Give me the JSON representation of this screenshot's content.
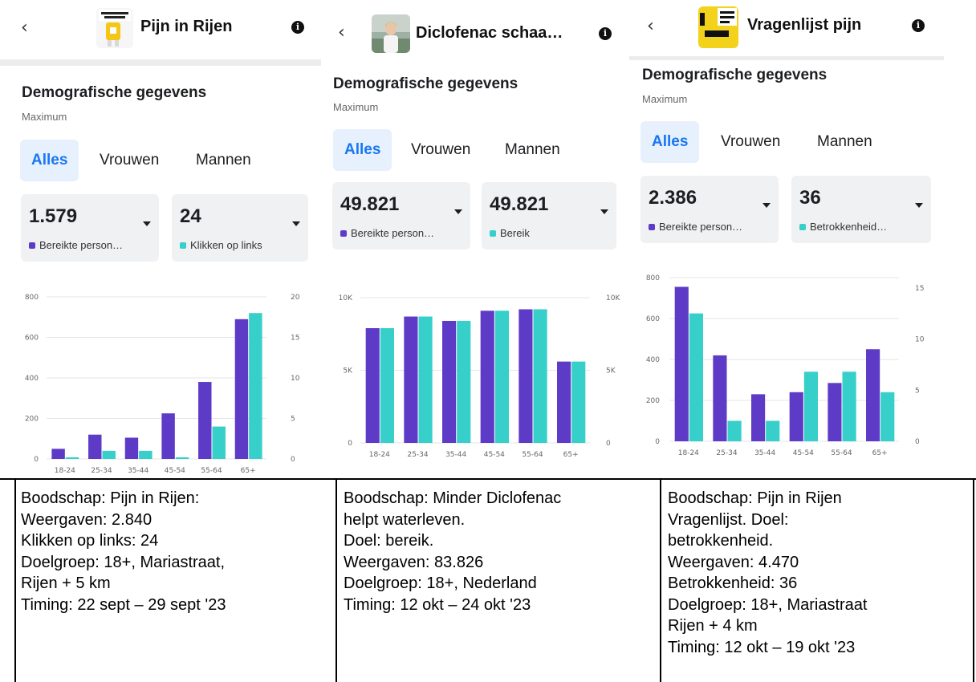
{
  "colors": {
    "purple": "#5e3bc6",
    "teal": "#36cfc9",
    "accent": "#1877f2"
  },
  "panels": [
    {
      "title": "Pijn in Rijen",
      "section_title": "Demografische gegevens",
      "section_sub": "Maximum",
      "tabs": [
        "Alles",
        "Vrouwen",
        "Mannen"
      ],
      "cards": [
        {
          "value": "1.579",
          "label": "Bereikte person…",
          "color": "#5e3bc6"
        },
        {
          "value": "24",
          "label": "Klikken op links",
          "color": "#36cfc9"
        }
      ],
      "chart_data": {
        "type": "bar",
        "categories": [
          "18-24",
          "25-34",
          "35-44",
          "45-54",
          "55-64",
          "65+"
        ],
        "series": [
          {
            "axis": "left",
            "values": [
              50,
              120,
              105,
              225,
              380,
              690
            ]
          },
          {
            "axis": "right",
            "values": [
              0.2,
              1,
              1,
              0.2,
              4,
              18
            ]
          }
        ],
        "left_ticks": [
          "0",
          "200",
          "400",
          "600",
          "800"
        ],
        "right_ticks": [
          "0",
          "5",
          "10",
          "15",
          "20"
        ],
        "ylim_left": [
          0,
          800
        ],
        "ylim_right": [
          0,
          20
        ]
      }
    },
    {
      "title": "Diclofenac schaa…",
      "section_title": "Demografische gegevens",
      "section_sub": "Maximum",
      "tabs": [
        "Alles",
        "Vrouwen",
        "Mannen"
      ],
      "cards": [
        {
          "value": "49.821",
          "label": "Bereikte person…",
          "color": "#5e3bc6"
        },
        {
          "value": "49.821",
          "label": "Bereik",
          "color": "#36cfc9"
        }
      ],
      "chart_data": {
        "type": "bar",
        "categories": [
          "18-24",
          "25-34",
          "35-44",
          "45-54",
          "55-64",
          "65+"
        ],
        "series": [
          {
            "axis": "left",
            "values": [
              7900,
              8700,
              8400,
              9100,
              9200,
              5600
            ]
          },
          {
            "axis": "right",
            "values": [
              7900,
              8700,
              8400,
              9100,
              9200,
              5600
            ]
          }
        ],
        "left_ticks": [
          "0",
          "5K",
          "10K"
        ],
        "right_ticks": [
          "0",
          "5K",
          "10K"
        ],
        "ylim_left": [
          0,
          10000
        ],
        "ylim_right": [
          0,
          10000
        ]
      }
    },
    {
      "title": "Vragenlijst pijn",
      "section_title": "Demografische gegevens",
      "section_sub": "Maximum",
      "tabs": [
        "Alles",
        "Vrouwen",
        "Mannen"
      ],
      "cards": [
        {
          "value": "2.386",
          "label": "Bereikte person…",
          "color": "#5e3bc6"
        },
        {
          "value": "36",
          "label": "Betrokkenheid…",
          "color": "#36cfc9"
        }
      ],
      "chart_data": {
        "type": "bar",
        "categories": [
          "18-24",
          "25-34",
          "35-44",
          "45-54",
          "55-64",
          "65+"
        ],
        "series": [
          {
            "axis": "left",
            "values": [
              755,
              420,
              230,
              240,
              285,
              450
            ]
          },
          {
            "axis": "right",
            "values": [
              12.5,
              2,
              2,
              6.8,
              6.8,
              4.8
            ]
          }
        ],
        "left_ticks": [
          "0",
          "200",
          "400",
          "600",
          "800"
        ],
        "right_ticks": [
          "0",
          "5",
          "10",
          "15"
        ],
        "ylim_left": [
          0,
          800
        ],
        "ylim_right": [
          0,
          16
        ]
      }
    }
  ],
  "captions": [
    [
      "Boodschap: Pijn in Rijen:",
      "Weergaven: 2.840",
      "Klikken op links: 24",
      "Doelgroep: 18+, Mariastraat,",
      "Rijen + 5 km",
      "Timing: 22 sept – 29 sept '23"
    ],
    [
      "Boodschap: Minder Diclofenac",
      "helpt waterleven.",
      "Doel: bereik.",
      "Weergaven: 83.826",
      "Doelgroep: 18+, Nederland",
      "Timing: 12 okt – 24 okt '23"
    ],
    [
      "Boodschap: Pijn in Rijen",
      "Vragenlijst. Doel:",
      "betrokkenheid.",
      "Weergaven: 4.470",
      "Betrokkenheid: 36",
      "Doelgroep: 18+, Mariastraat",
      "Rijen + 4 km",
      "Timing: 12 okt – 19 okt '23"
    ]
  ]
}
